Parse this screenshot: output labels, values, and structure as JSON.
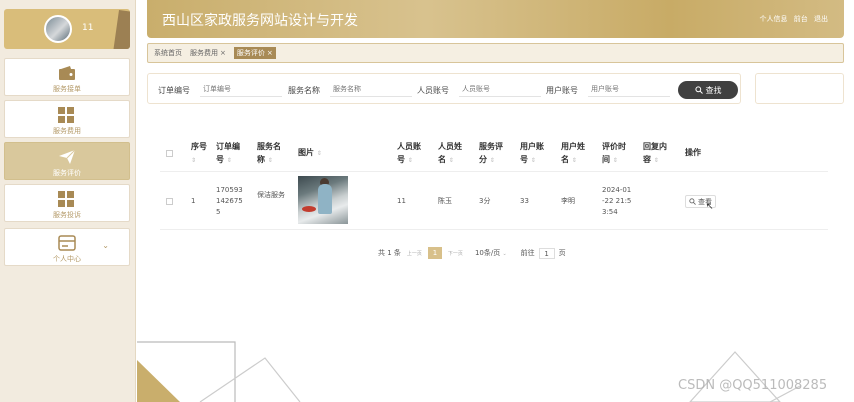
{
  "app": {
    "title": "西山区家政服务网站设计与开发",
    "header_links": [
      "个人信息",
      "前台",
      "退出"
    ]
  },
  "user": {
    "name": "11"
  },
  "sidebar": {
    "items": [
      {
        "label": "服务接单",
        "icon": "wallet-icon",
        "active": false
      },
      {
        "label": "服务费用",
        "icon": "grid-icon",
        "active": false
      },
      {
        "label": "服务评价",
        "icon": "paper-plane-icon",
        "active": true
      },
      {
        "label": "服务投诉",
        "icon": "grid-icon",
        "active": false
      },
      {
        "label": "个人中心",
        "icon": "card-icon",
        "active": false,
        "chevron": "⌄"
      }
    ]
  },
  "breadcrumb": {
    "items": [
      {
        "label": "系统首页",
        "closable": false,
        "active": false
      },
      {
        "label": "服务费用",
        "closable": true,
        "active": false
      },
      {
        "label": "服务评价",
        "closable": true,
        "active": true
      }
    ],
    "close_glyph": "×"
  },
  "search": {
    "fields": [
      {
        "label": "订单编号",
        "placeholder": "订单编号"
      },
      {
        "label": "服务名称",
        "placeholder": "服务名称"
      },
      {
        "label": "人员账号",
        "placeholder": "人员账号"
      },
      {
        "label": "用户账号",
        "placeholder": "用户账号"
      }
    ],
    "button_label": "查找"
  },
  "table": {
    "headers": [
      "序号",
      "订单编号",
      "服务名称",
      "图片",
      "人员账号",
      "人员姓名",
      "服务评分",
      "用户账号",
      "用户姓名",
      "评价时间",
      "回复内容",
      "操作"
    ],
    "sort_glyph": "⇕",
    "rows": [
      {
        "index": "1",
        "order_no": "1705931426755",
        "service_name": "保洁服务",
        "staff_account": "11",
        "staff_name": "陈玉",
        "score": "3分",
        "user_account": "33",
        "user_name": "李明",
        "eval_time": "2024-01-22 21:53:54",
        "reply": "",
        "action_label": "查看"
      }
    ]
  },
  "pagination": {
    "total_text": "共 1 条",
    "prev": "上一页",
    "current_page": "1",
    "next": "下一页",
    "page_size": "10条/页",
    "goto_label": "前往",
    "goto_value": "1",
    "page_unit": "页"
  },
  "watermark": "CSDN @QQ511008285"
}
